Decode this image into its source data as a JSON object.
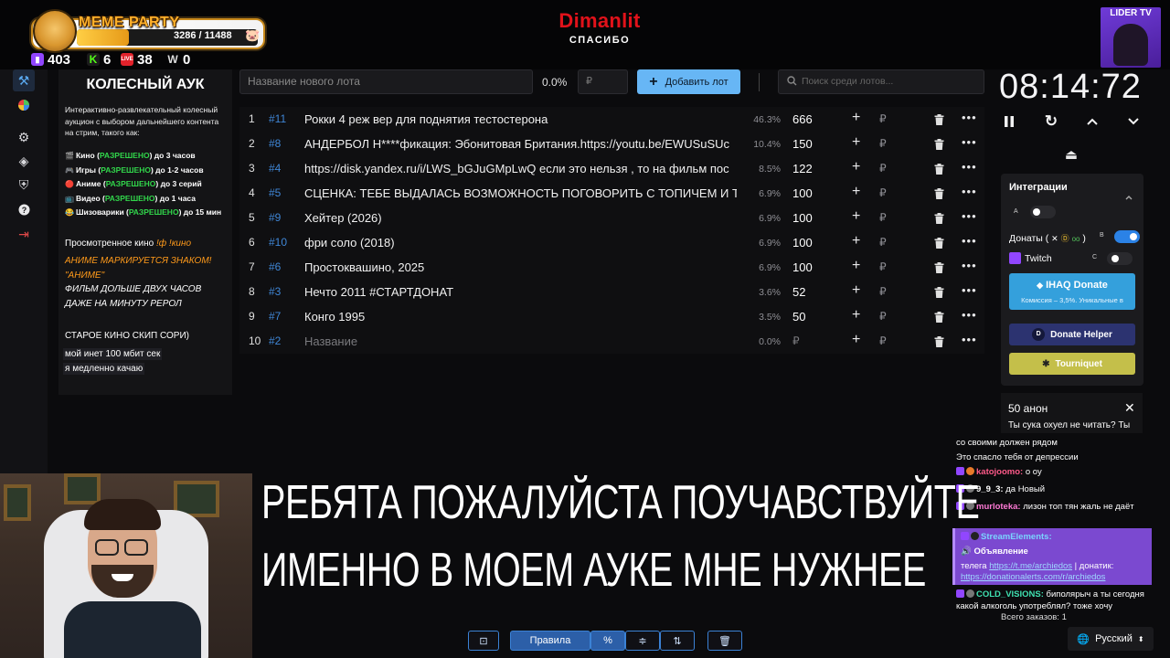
{
  "header": {
    "meme_party": {
      "title": "MEME PARTY",
      "count": "3286 / 11488",
      "progress": 0.286
    },
    "stats": [
      {
        "icon": "twitch-icon",
        "value": "403",
        "color": "#9146ff"
      },
      {
        "icon": "kick-icon",
        "value": "6",
        "color": "#53fc18"
      },
      {
        "icon": "live-icon",
        "value": "38",
        "color": "#e3222b"
      },
      {
        "icon": "w-icon",
        "value": "0",
        "color": "#dddddd"
      }
    ],
    "brand_name": "Dimanlit",
    "brand_sub": "СПАСИБО",
    "lider": "LIDER TV"
  },
  "nav": [
    "gavel-icon",
    "wheel-icon",
    "gear-icon",
    "layers-icon",
    "shield-icon",
    "help-icon",
    "logout-icon"
  ],
  "info": {
    "title": "КОЛЕСНЫЙ АУК",
    "desc": "Интерактивно-развлекательный колесный аукцион с выбором дальнейшего контента на стрим, такого как:",
    "rules": [
      {
        "emoji": "🎬",
        "pre": "Кино (",
        "ok": "РАЗРЕШЕНО",
        "post": ") до 3 часов"
      },
      {
        "emoji": "🎮",
        "pre": "Игры (",
        "ok": "РАЗРЕШЕНО",
        "post": ") до 1-2 часов"
      },
      {
        "emoji": "🔴",
        "pre": "Аниме (",
        "ok": "РАЗРЕШЕНО",
        "post": ") до 3 серий"
      },
      {
        "emoji": "📺",
        "pre": "Видео (",
        "ok": "РАЗРЕШЕНО",
        "post": ") до 1 часа"
      },
      {
        "emoji": "😂",
        "pre": "Шизоварики (",
        "ok": "РАЗРЕШЕНО",
        "post": ") до 15 мин"
      }
    ],
    "watched": "Просмотренное кино",
    "watched_cmd": "!ф !кино",
    "warn1": "АНИМЕ МАРКИРУЕТСЯ ЗНАКОМ!",
    "warn2": "\"АНИМЕ\"",
    "warn3": "ФИЛЬМ ДОЛЬШЕ ДВУХ ЧАСОВ",
    "warn4": "ДАЖЕ НА МИНУТУ РЕРОЛ",
    "old": "СТАРОЕ КИНО СКИП СОРИ)",
    "inet1": "мой инет 100 мбит сек",
    "inet2": "я медленно качаю"
  },
  "add_row": {
    "name_placeholder": "Название нового лота",
    "percent": "0.0%",
    "amount_placeholder": "₽",
    "add_label": "Добавить лот",
    "search_placeholder": "Поиск среди лотов..."
  },
  "lots": [
    {
      "n": "1",
      "id": "#11",
      "name": "Рокки 4 реж вер для поднятия тестостерона",
      "pct": "46.3%",
      "amount": "666"
    },
    {
      "n": "2",
      "id": "#8",
      "name": "АНДЕРБОЛ Н****фикация: Эбонитовая Британия.https://youtu.be/EWUSuSUc",
      "pct": "10.4%",
      "amount": "150"
    },
    {
      "n": "3",
      "id": "#4",
      "name": "https://disk.yandex.ru/i/LWS_bGJuGMpLwQ  если это нельзя , то на фильм пос",
      "pct": "8.5%",
      "amount": "122"
    },
    {
      "n": "4",
      "id": "#5",
      "name": "СЦЕНКА: ТЕБЕ ВЫДАЛАСЬ ВОЗМОЖНОСТЬ ПОГОВОРИТЬ С ТОПИЧЕМ И ТЬ",
      "pct": "6.9%",
      "amount": "100"
    },
    {
      "n": "5",
      "id": "#9",
      "name": "Хейтер (2026)",
      "pct": "6.9%",
      "amount": "100"
    },
    {
      "n": "6",
      "id": "#10",
      "name": " фри соло (2018)",
      "pct": "6.9%",
      "amount": "100"
    },
    {
      "n": "7",
      "id": "#6",
      "name": "Простоквашино, 2025",
      "pct": "6.9%",
      "amount": "100"
    },
    {
      "n": "8",
      "id": "#3",
      "name": "Нечто 2011 #СТАРТДОНАТ",
      "pct": "3.6%",
      "amount": "52"
    },
    {
      "n": "9",
      "id": "#7",
      "name": "Конго 1995",
      "pct": "3.5%",
      "amount": "50"
    },
    {
      "n": "10",
      "id": "#2",
      "name": "Название",
      "pct": "0.0%",
      "amount": "₽",
      "placeholder": true
    }
  ],
  "row_icons": {
    "plus": "+",
    "rub": "₽",
    "more": "•••"
  },
  "timer": "08:14:72",
  "integrations": {
    "title": "Интеграции",
    "donaty": "Донаты (",
    "donaty_close": ")",
    "twitch": "Twitch",
    "ihaq_title": "IHAQ Donate",
    "ihaq_sub": "Комиссия – 3,5%. Уникальные в",
    "donate_helper": "Donate Helper",
    "tourniquet": "Tourniquet"
  },
  "anon": {
    "title": "50 анон",
    "text": "Ты сука охуел не читать? Ты"
  },
  "chat": [
    {
      "user": "",
      "text": "со своими должен рядом"
    },
    {
      "user": "",
      "text": "Это спасло тебя от депрессии"
    },
    {
      "user": "katojoomo:",
      "ucolor": "#ff5a8a",
      "text": " о оу"
    },
    {
      "user": "9_9_3:",
      "ucolor": "#ffffff",
      "text": " да   Новый"
    },
    {
      "user": "murloteka:",
      "ucolor": "#ff7ad6",
      "text": " лизон топ тян жаль не даёт"
    },
    {
      "user": "COLD_VISIONS:",
      "ucolor": "#3fe0b0",
      "text": " биполярыч а ты сегодня какой алкоголь употреблял? тоже хочу"
    }
  ],
  "se": {
    "user": "StreamElements:",
    "title": "Объявление",
    "line1": "телега ",
    "link1": "https://t.me/archiedos",
    "line2": " | донатик:",
    "link2": "https://donationalerts.com/r/archiedos"
  },
  "orders": "Всего заказов:  1",
  "lang": "Русский",
  "caption": [
    "РЕБЯТА ПОЖАЛУЙСТА ПОУЧАВСТВУЙТЕ",
    "ИМЕННО В МОЕМ АУКЕ МНЕ НУЖНЕЕ"
  ],
  "toolbar": {
    "rules": "Правила",
    "percent": "%"
  }
}
